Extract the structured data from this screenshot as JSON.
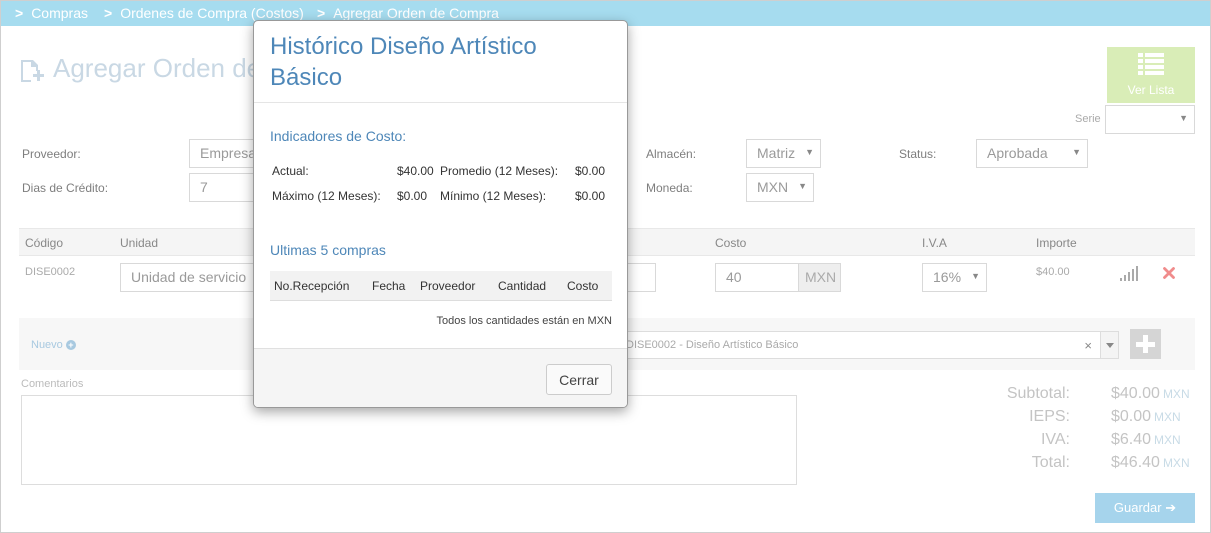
{
  "breadcrumb": {
    "items": [
      "Compras",
      "Ordenes de Compra (Costos)",
      "Agregar Orden de Compra"
    ]
  },
  "page": {
    "title": "Agregar Orden de",
    "ver_lista": "Ver Lista"
  },
  "form": {
    "serie_label": "Serie",
    "proveedor_label": "Proveedor:",
    "proveedor_placeholder": "Empresa",
    "dias_credito_label": "Dias de Crédito:",
    "dias_credito_value": "7",
    "almacen_label": "Almacén:",
    "almacen_value": "Matriz",
    "moneda_label": "Moneda:",
    "moneda_value": "MXN",
    "status_label": "Status:",
    "status_value": "Aprobada"
  },
  "table": {
    "headers": {
      "codigo": "Código",
      "unidad": "Unidad",
      "costo": "Costo",
      "iva": "I.V.A",
      "importe": "Importe"
    },
    "row": {
      "codigo": "DISE0002",
      "unidad_placeholder": "Unidad de servicio",
      "costo": "40",
      "costo_currency": "MXN",
      "iva": "16%",
      "importe": "$40.00"
    }
  },
  "newrow": {
    "label": "Nuevo",
    "product_select": "DISE0002 - Diseño Artístico Básico"
  },
  "comentarios_label": "Comentarios",
  "totals": {
    "currency": "MXN",
    "subtotal_label": "Subtotal:",
    "subtotal": "$40.00",
    "ieps_label": "IEPS:",
    "ieps": "$0.00",
    "iva_label": "IVA:",
    "iva": "$6.40",
    "total_label": "Total:",
    "total": "$46.40"
  },
  "save_label": "Guardar",
  "modal": {
    "title": "Histórico Diseño Artístico Básico",
    "indicadores_title": "Indicadores de Costo:",
    "actual_label": "Actual:",
    "actual": "$40.00",
    "promedio_label": "Promedio (12 Meses):",
    "promedio": "$0.00",
    "maximo_label": "Máximo (12 Meses):",
    "maximo": "$0.00",
    "minimo_label": "Mínimo (12 Meses):",
    "minimo": "$0.00",
    "ultimas_title": "Ultimas 5 compras",
    "columns": [
      "No.Recepción",
      "Fecha",
      "Proveedor",
      "Cantidad",
      "Costo"
    ],
    "note": "Todos los cantidades están en MXN",
    "close_label": "Cerrar"
  },
  "colors": {
    "breadcrumb_bg": "#a6dcef",
    "accent": "#4e87b8",
    "ver_lista_bg": "#d9edb7",
    "save_bg": "#a6d4ec",
    "delete": "#f08c8c"
  }
}
